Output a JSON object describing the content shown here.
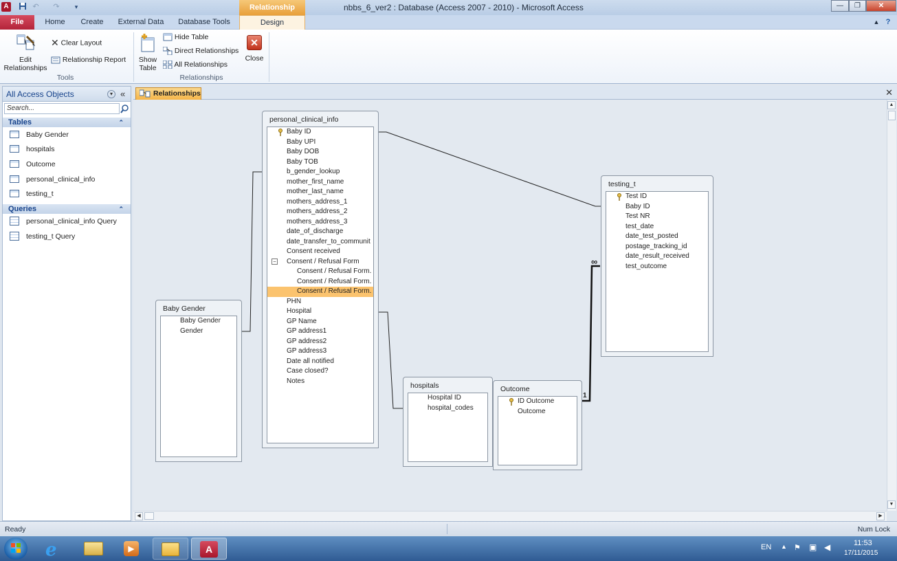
{
  "window": {
    "title": "nbbs_6_ver2 : Database (Access 2007 - 2010)  -  Microsoft Access",
    "context_tab_group": "Relationship Tools",
    "app_icon_letter": "A"
  },
  "tabs": {
    "file": "File",
    "home": "Home",
    "create": "Create",
    "external_data": "External Data",
    "database_tools": "Database Tools",
    "design": "Design"
  },
  "ribbon": {
    "edit_relationships": [
      "Edit",
      "Relationships"
    ],
    "clear_layout": "Clear Layout",
    "relationship_report": "Relationship Report",
    "tools_group": "Tools",
    "show_table": [
      "Show",
      "Table"
    ],
    "hide_table": "Hide Table",
    "direct_relationships": "Direct Relationships",
    "all_relationships": "All Relationships",
    "close": "Close",
    "relationships_group": "Relationships"
  },
  "nav": {
    "header": "All Access Objects",
    "search_placeholder": "Search...",
    "tables_section": "Tables",
    "tables": [
      "Baby Gender",
      "hospitals",
      "Outcome",
      "personal_clinical_info",
      "testing_t"
    ],
    "queries_section": "Queries",
    "queries": [
      "personal_clinical_info Query",
      "testing_t Query"
    ]
  },
  "document": {
    "tab_label": "Relationships"
  },
  "diagram": {
    "personal_clinical_info": {
      "title": "personal_clinical_info",
      "fields": [
        "Baby ID",
        "Baby UPI",
        "Baby DOB",
        "Baby TOB",
        "b_gender_lookup",
        "mother_first_name",
        "mother_last_name",
        "mothers_address_1",
        "mothers_address_2",
        "mothers_address_3",
        "date_of_discharge",
        "date_transfer_to_communit",
        "Consent received",
        "Consent / Refusal Form",
        "Consent / Refusal Form.",
        "Consent / Refusal Form.",
        "Consent / Refusal Form.",
        "PHN",
        "Hospital",
        "GP Name",
        "GP address1",
        "GP address2",
        "GP address3",
        "Date all notified",
        "Case closed?",
        "Notes"
      ]
    },
    "baby_gender": {
      "title": "Baby Gender",
      "fields": [
        "Baby Gender",
        "Gender"
      ]
    },
    "hospitals": {
      "title": "hospitals",
      "fields": [
        "Hospital ID",
        "hospital_codes"
      ]
    },
    "outcome": {
      "title": "Outcome",
      "fields": [
        "ID Outcome",
        "Outcome"
      ]
    },
    "testing_t": {
      "title": "testing_t",
      "fields": [
        "Test ID",
        "Baby ID",
        "Test NR",
        "test_date",
        "date_test_posted",
        "postage_tracking_id",
        "date_result_received",
        "test_outcome"
      ]
    },
    "rel_one": "1",
    "rel_many": "∞"
  },
  "status": {
    "left": "Ready",
    "right": "Num Lock"
  },
  "taskbar": {
    "language": "EN",
    "time": "11:53",
    "date": "17/11/2015"
  },
  "colors": {
    "access_red": "#a8162b",
    "context_orange": "#f0b040",
    "selected_field": "#fbc36e"
  }
}
